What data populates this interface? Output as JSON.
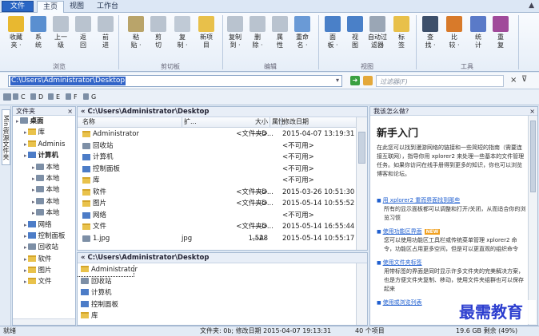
{
  "menu": {
    "button": "文件",
    "tabs": [
      "主页",
      "视图",
      "工作台"
    ]
  },
  "ribbon": {
    "groups": [
      "浏览",
      "剪切板",
      "编辑",
      "视图",
      "工具"
    ],
    "buttons": [
      {
        "label": "收藏\n夹 ·",
        "icon": "star-icon",
        "color": "#e8b830"
      },
      {
        "label": "系\n统",
        "icon": "system-icon",
        "color": "#5a8fd0"
      },
      {
        "label": "上一\n级",
        "icon": "up-icon",
        "color": "#b9c3cf"
      },
      {
        "label": "返\n回",
        "icon": "back-icon",
        "color": "#b9c3cf"
      },
      {
        "label": "前\n进",
        "icon": "forward-icon",
        "color": "#b9c3cf"
      },
      {
        "label": "粘\n贴 ·",
        "icon": "paste-icon",
        "color": "#b9a46a"
      },
      {
        "label": "剪\n切",
        "icon": "cut-icon",
        "color": "#b9c3cf"
      },
      {
        "label": "复\n制 ·",
        "icon": "copy-icon",
        "color": "#c0cad6"
      },
      {
        "label": "新项\n目",
        "icon": "new-folder-icon",
        "color": "#e8c04a"
      },
      {
        "label": "复制\n到 ·",
        "icon": "copy-to-icon",
        "color": "#b9c3cf"
      },
      {
        "label": "删\n除 ·",
        "icon": "delete-icon",
        "color": "#b9c3cf"
      },
      {
        "label": "属\n性",
        "icon": "properties-icon",
        "color": "#b9c3cf"
      },
      {
        "label": "重命\n名 ·",
        "icon": "rename-icon",
        "color": "#6a9ad6"
      },
      {
        "label": "面\n板 ·",
        "icon": "panel-icon",
        "color": "#4a80c8"
      },
      {
        "label": "视\n图",
        "icon": "view-icon",
        "color": "#4a80c8"
      },
      {
        "label": "自动过\n滤器",
        "icon": "filter-icon",
        "color": "#9aa6b5"
      },
      {
        "label": "标\n签",
        "icon": "tag-icon",
        "color": "#e8c04a"
      },
      {
        "label": "查\n找 ·",
        "icon": "binoculars-icon",
        "color": "#3d4f6a"
      },
      {
        "label": "比\n较 ·",
        "icon": "compare-icon",
        "color": "#d87a2a"
      },
      {
        "label": "统\n计",
        "icon": "stats-icon",
        "color": "#5a7ac8"
      },
      {
        "label": "重\n复",
        "icon": "duplicate-icon",
        "color": "#a04a9a"
      }
    ]
  },
  "address": {
    "value": "C:\\Users\\Administrator\\Desktop",
    "filter_placeholder": "过滤器(F)"
  },
  "drives": [
    "C",
    "D",
    "E",
    "F",
    "G"
  ],
  "side_tab": "Mini资源文件夹",
  "tree": {
    "header": "文件夹",
    "items": [
      {
        "label": "桌面",
        "level": 0,
        "type": "drv"
      },
      {
        "label": "库",
        "level": 1,
        "type": "fold"
      },
      {
        "label": "Adminis",
        "level": 1,
        "type": "fold"
      },
      {
        "label": "计算机",
        "level": 1,
        "type": "comp"
      },
      {
        "label": "本地",
        "level": 2,
        "type": "drv"
      },
      {
        "label": "本地",
        "level": 2,
        "type": "drv"
      },
      {
        "label": "本地",
        "level": 2,
        "type": "drv"
      },
      {
        "label": "本地",
        "level": 2,
        "type": "drv"
      },
      {
        "label": "本地",
        "level": 2,
        "type": "drv"
      },
      {
        "label": "网络",
        "level": 1,
        "type": "comp"
      },
      {
        "label": "控制面板",
        "level": 1,
        "type": "comp"
      },
      {
        "label": "回收站",
        "level": 1,
        "type": "drv"
      },
      {
        "label": "软件",
        "level": 1,
        "type": "fold"
      },
      {
        "label": "图片",
        "level": 1,
        "type": "fold"
      },
      {
        "label": "文件",
        "level": 1,
        "type": "fold"
      }
    ]
  },
  "pane_top": {
    "path": "« C:\\Users\\Administrator\\Desktop",
    "columns": [
      "名称",
      "扩...",
      "大小",
      "属性",
      "修改日期"
    ],
    "rows": [
      {
        "name": "Administrator",
        "ext": "",
        "size": "<文件夹>",
        "attr": "----D...",
        "date": "2015-04-07 13:19:31",
        "type": "fold"
      },
      {
        "name": "回收站",
        "ext": "",
        "size": "",
        "attr": "",
        "date": "<不可用>",
        "type": "drv"
      },
      {
        "name": "计算机",
        "ext": "",
        "size": "",
        "attr": "",
        "date": "<不可用>",
        "type": "comp"
      },
      {
        "name": "控制面板",
        "ext": "",
        "size": "",
        "attr": "",
        "date": "<不可用>",
        "type": "comp"
      },
      {
        "name": "库",
        "ext": "",
        "size": "",
        "attr": "",
        "date": "<不可用>",
        "type": "fold"
      },
      {
        "name": "软件",
        "ext": "",
        "size": "<文件夹>",
        "attr": "----D...",
        "date": "2015-03-26 10:51:30",
        "type": "fold"
      },
      {
        "name": "图片",
        "ext": "",
        "size": "<文件夹>",
        "attr": "----D...",
        "date": "2015-05-14 10:55:52",
        "type": "fold"
      },
      {
        "name": "网络",
        "ext": "",
        "size": "",
        "attr": "",
        "date": "<不可用>",
        "type": "comp"
      },
      {
        "name": "文件",
        "ext": "",
        "size": "<文件夹>",
        "attr": "----D...",
        "date": "2015-05-14 16:55:44",
        "type": "fold"
      },
      {
        "name": "1.jpg",
        "ext": "jpg",
        "size": "1,528",
        "attr": "---A-",
        "date": "2015-05-14 10:55:17",
        "type": "drv"
      }
    ]
  },
  "pane_bottom": {
    "path": "« C:\\Users\\Administrator\\Desktop",
    "rows": [
      {
        "name": "Administrator",
        "type": "fold"
      },
      {
        "name": "回收站",
        "type": "drv"
      },
      {
        "name": "计算机",
        "type": "comp"
      },
      {
        "name": "控制面板",
        "type": "comp"
      },
      {
        "name": "库",
        "type": "fold"
      }
    ]
  },
  "help": {
    "header": "我该怎么做?",
    "title": "新手入门",
    "intro": "在此您可以找到漫游网络的链接和一些简短的指南（需要连接互联网），指导你用 xplorer2 来处理一些基本的文件管理任务。如果你访问在线手册得到更多的知识，你也可以浏览博客和论坛。",
    "items": [
      {
        "link": "用 xplorer2 重而界面找到那些",
        "text": "所有的显示面板都可以调整和打开/关闭，从而适合你的浏览习惯",
        "badge": ""
      },
      {
        "link": "使用功能区界面",
        "text": "您可以使用功能区工具栏或传统菜单管理 xplorer2 命令，功能区占用更多空间，但是可以更直观的组织命令",
        "badge": "NEW"
      },
      {
        "link": "使用文件夹标签",
        "text": "用带标签的界面是同时显示许多文件夹的完美解决方案，也是方便文件夹复制、移动，使用文件夹组群也可以保存起来",
        "badge": ""
      },
      {
        "link": "使用或浏览列表",
        "text": "",
        "badge": ""
      }
    ]
  },
  "status": {
    "left": "就绪",
    "middle": "文件夹: 0b; 修改日期 2015-04-07 19:13:31",
    "count": "40 个项目",
    "disk": "19.6 GB 剩余 (49%)"
  },
  "watermark": "最需教育",
  "colors": {
    "accent": "#3164c8",
    "ribbon": "#e6eef8",
    "link": "#1f5fd0",
    "badge": "#f0a020"
  }
}
